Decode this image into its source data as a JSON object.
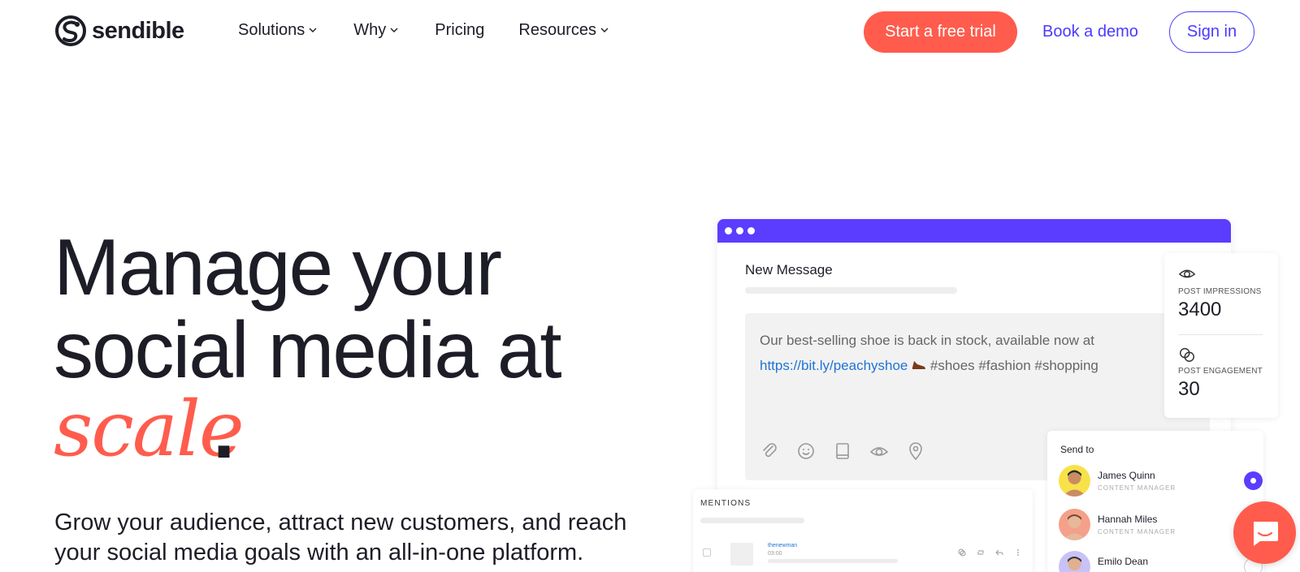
{
  "header": {
    "brand": "sendible",
    "nav": [
      {
        "label": "Solutions",
        "has_dropdown": true
      },
      {
        "label": "Why",
        "has_dropdown": true
      },
      {
        "label": "Pricing",
        "has_dropdown": false
      },
      {
        "label": "Resources",
        "has_dropdown": true
      }
    ],
    "trial_label": "Start a free trial",
    "demo_label": "Book a demo",
    "signin_label": "Sign in"
  },
  "hero": {
    "title": "Manage your social media at",
    "accent": "scale",
    "period": ".",
    "subtitle": "Grow your audience, attract new customers, and reach your social media goals with an all-in-one platform."
  },
  "mock": {
    "new_message": "New Message",
    "compose_text": "Our best-selling shoe is back in stock, available now at",
    "compose_link": "https://bit.ly/peachyshoe",
    "compose_tags": "#shoes #fashion #shopping",
    "compose_tools": [
      "paperclip-icon",
      "smiley-icon",
      "book-icon",
      "eye-icon",
      "location-pin-icon"
    ],
    "stats": [
      {
        "label": "POST IMPRESSIONS",
        "value": "3400",
        "icon": "eye-icon"
      },
      {
        "label": "POST ENGAGEMENT",
        "value": "30",
        "icon": "engagement-icon"
      }
    ],
    "send_to": {
      "title": "Send to",
      "contacts": [
        {
          "name": "James Quinn",
          "role": "CONTENT MANAGER",
          "selected": true
        },
        {
          "name": "Hannah Miles",
          "role": "CONTENT MANAGER",
          "selected": false
        },
        {
          "name": "Emilo Dean",
          "role": "",
          "selected": false
        }
      ]
    },
    "mentions": {
      "title": "MENTIONS",
      "row": {
        "user": "thenewman",
        "time": "03:00"
      }
    }
  },
  "colors": {
    "accent": "#ff5c4d",
    "brand_purple": "#4a3aff",
    "window_bar": "#5a3dff",
    "link": "#1f74d6"
  }
}
